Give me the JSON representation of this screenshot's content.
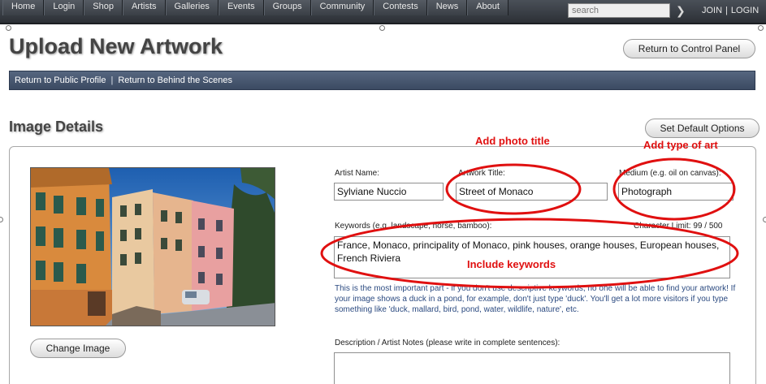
{
  "nav": {
    "items": [
      "Home",
      "Login",
      "Shop",
      "Artists",
      "Galleries",
      "Events",
      "Groups",
      "Community",
      "Contests",
      "News",
      "About"
    ],
    "search_placeholder": "search",
    "join": "JOIN",
    "separator": "|",
    "login": "LOGIN"
  },
  "header": {
    "title": "Upload New Artwork",
    "return_button": "Return to Control Panel"
  },
  "subnav": {
    "public_profile": "Return to Public Profile",
    "divider": "|",
    "behind_scenes": "Return to Behind the Scenes"
  },
  "details": {
    "section_title": "Image Details",
    "default_options_button": "Set Default Options",
    "change_image_button": "Change Image",
    "artist_name_label": "Artist Name:",
    "artist_name_value": "Sylviane Nuccio",
    "artwork_title_label": "Artwork Title:",
    "artwork_title_value": "Street of Monaco",
    "medium_label": "Medium (e.g. oil on canvas):",
    "medium_value": "Photograph",
    "keywords_label": "Keywords (e.g. landscape, horse, bamboo):",
    "character_limit": "Character Limit: 99 / 500",
    "keywords_value": "France, Monaco, principality of Monaco, pink houses, orange houses, European houses, French Riviera",
    "keywords_hint": "This is the most important part - if you don't use descriptive keywords, no one will be able to find your artwork!   If your image shows a duck in a pond, for example, don't just type 'duck'. You'll get a lot more visitors if you type something like 'duck, mallard, bird, pond, water, wildlife, nature', etc.",
    "description_label": "Description / Artist Notes (please write in complete sentences):",
    "description_value": ""
  },
  "annotations": {
    "photo_title": "Add photo title",
    "type_of_art": "Add type of art",
    "keywords": "Include keywords",
    "color": "#e01010"
  }
}
